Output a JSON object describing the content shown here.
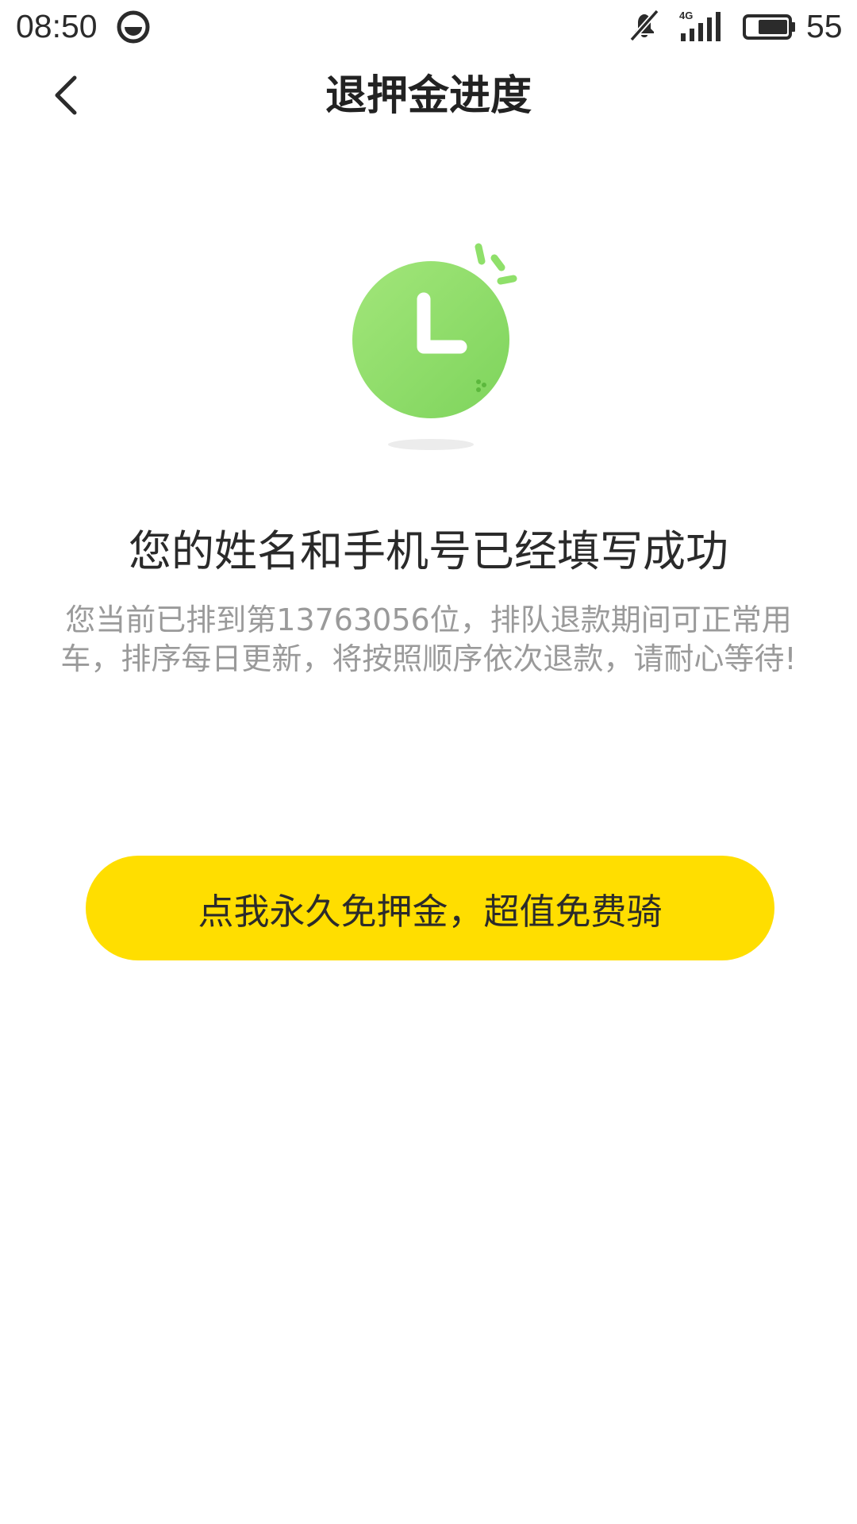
{
  "status_bar": {
    "time": "08:50",
    "network": "4G",
    "battery": "55"
  },
  "header": {
    "title": "退押金进度",
    "back_icon": "chevron-left-icon"
  },
  "illustration": {
    "icon": "clock-icon",
    "color": "#8fe06a"
  },
  "main": {
    "success_title": "您的姓名和手机号已经填写成功",
    "description": "您当前已排到第13763056位，排队退款期间可正常用车，排序每日更新，将按照顺序依次退款，请耐心等待!"
  },
  "cta": {
    "label": "点我永久免押金，超值免费骑",
    "color": "#ffde00"
  }
}
